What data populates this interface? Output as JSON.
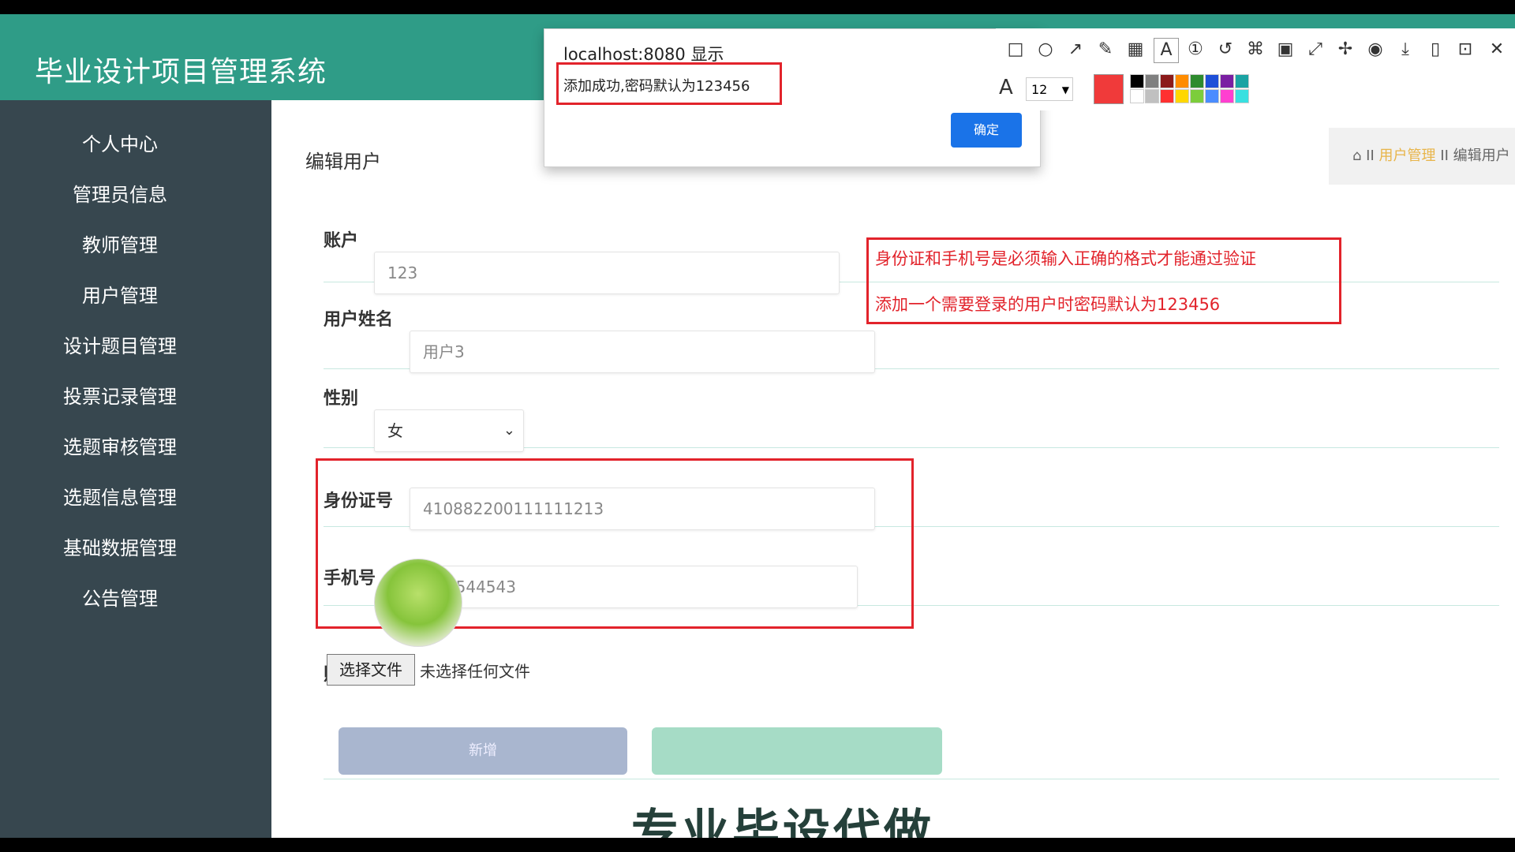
{
  "app": {
    "title": "毕业设计项目管理系统"
  },
  "sidebar": {
    "items": [
      {
        "label": "个人中心"
      },
      {
        "label": "管理员信息"
      },
      {
        "label": "教师管理"
      },
      {
        "label": "用户管理"
      },
      {
        "label": "设计题目管理"
      },
      {
        "label": "投票记录管理"
      },
      {
        "label": "选题审核管理"
      },
      {
        "label": "选题信息管理"
      },
      {
        "label": "基础数据管理"
      },
      {
        "label": "公告管理"
      }
    ]
  },
  "page": {
    "title": "编辑用户"
  },
  "breadcrumb": {
    "icon": "home-icon",
    "separator": "II",
    "parent": "用户管理",
    "current": "编辑用户"
  },
  "form": {
    "account": {
      "label": "账户",
      "value": "123"
    },
    "name": {
      "label": "用户姓名",
      "value": "用户3"
    },
    "gender": {
      "label": "性别",
      "value": "女"
    },
    "id_card": {
      "label": "身份证号",
      "value": "410882200111111213"
    },
    "phone": {
      "label": "手机号",
      "value": "17745544543"
    },
    "photo": {
      "label": "照片",
      "choose_label": "选择文件",
      "no_file_text": "未选择任何文件"
    },
    "submit_label": "新增"
  },
  "annotation": {
    "line1": "身份证和手机号是必须输入正确的格式才能通过验证",
    "line2": "添加一个需要登录的用户时密码默认为123456",
    "color": "#e2232b"
  },
  "dialog": {
    "origin": "localhost:8080 显示",
    "message": "添加成功,密码默认为123456",
    "ok_label": "确定"
  },
  "toolbar": {
    "icons": [
      "rectangle-icon",
      "ellipse-icon",
      "arrow-icon",
      "pencil-icon",
      "mosaic-icon",
      "text-icon",
      "number-icon",
      "undo-icon",
      "pin-icon",
      "ocr-icon",
      "fullscreen-icon",
      "sticky-icon",
      "record-icon",
      "download-icon",
      "copy-icon",
      "save-icon",
      "close-icon"
    ],
    "font_size": "12",
    "current_color": "#f03a3a",
    "palette": [
      "#000000",
      "#808080",
      "#8b1a1a",
      "#ff8c00",
      "#2e8b2e",
      "#1e4fd8",
      "#7a1fa2",
      "#1aa3a3",
      "#ffffff",
      "#c0c0c0",
      "#ff3030",
      "#ffd700",
      "#7ccd3b",
      "#4a8cff",
      "#ff3fd0",
      "#38e0e0"
    ]
  },
  "watermark": {
    "text": "专业毕设代做"
  },
  "header": {
    "icons": [
      "fullscreen-icon",
      "user-icon"
    ]
  }
}
